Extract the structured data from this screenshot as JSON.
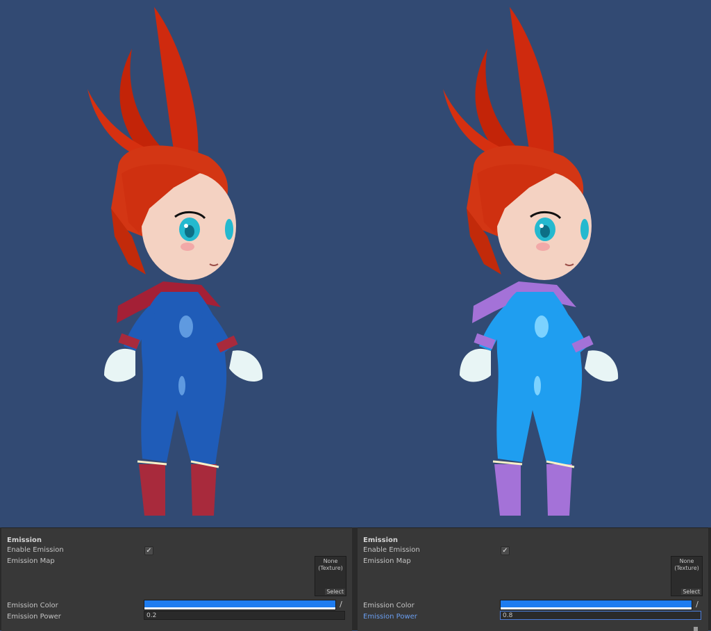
{
  "panels": [
    {
      "title": "Emission",
      "enable_label": "Enable Emission",
      "enable_checked": true,
      "checkmark": "✓",
      "map_label": "Emission Map",
      "map_value": "None",
      "map_type": "(Texture)",
      "select_label": "Select",
      "color_label": "Emission Color",
      "color": "#1e7cf0",
      "power_label": "Emission Power",
      "power_value": "0.2",
      "picker_icon": "eyedropper-icon"
    },
    {
      "title": "Emission",
      "enable_label": "Enable Emission",
      "enable_checked": true,
      "checkmark": "✓",
      "map_label": "Emission Map",
      "map_value": "None",
      "map_type": "(Texture)",
      "select_label": "Select",
      "color_label": "Emission Color",
      "color": "#1e7cf0",
      "power_label": "Emission Power",
      "power_value": "0.8",
      "picker_icon": "eyedropper-icon"
    }
  ],
  "colors": {
    "viewport_bg": "#324a73",
    "panel_bg": "#383838",
    "focus": "#4a7cd8",
    "left_suit": "#1f5cb8",
    "left_accent": "#a82a3c",
    "right_suit": "#1f9ef0",
    "right_accent": "#a472d8",
    "hair": "#d42a10",
    "skin": "#f4d2c2"
  }
}
